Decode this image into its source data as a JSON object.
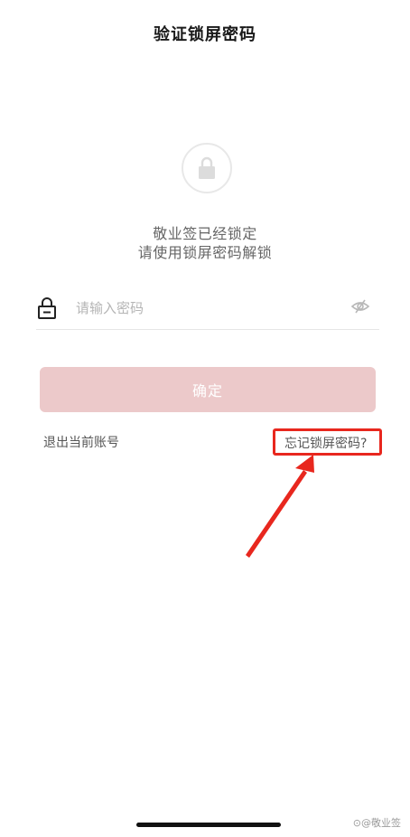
{
  "header": {
    "title": "验证锁屏密码"
  },
  "status": {
    "line1": "敬业签已经锁定",
    "line2": "请使用锁屏密码解锁"
  },
  "password": {
    "placeholder": "请输入密码",
    "value": ""
  },
  "actions": {
    "confirm_label": "确定",
    "logout_label": "退出当前账号",
    "forgot_label": "忘记锁屏密码?"
  },
  "colors": {
    "confirm_bg": "#ecc9ca",
    "highlight": "#e8271e"
  },
  "watermark": {
    "text": "⊙@敬业签"
  },
  "icons": {
    "lock_badge": "lock-icon",
    "password_lock": "padlock-icon",
    "visibility": "eye-off-icon"
  }
}
